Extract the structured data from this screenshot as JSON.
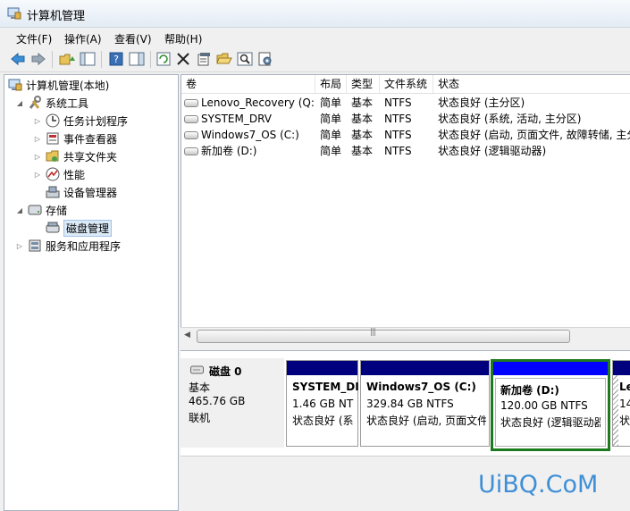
{
  "window": {
    "title": "计算机管理"
  },
  "menu": [
    "文件(F)",
    "操作(A)",
    "查看(V)",
    "帮助(H)"
  ],
  "toolbar": [
    "back-icon",
    "forward-icon",
    "up-folder-icon",
    "show-hide-tree-icon",
    "help-icon",
    "panel-icon",
    "refresh-icon",
    "delete-icon",
    "properties-icon",
    "open-icon",
    "search-icon",
    "settings-icon"
  ],
  "tree": {
    "root": "计算机管理(本地)",
    "system_tools": "系统工具",
    "task_scheduler": "任务计划程序",
    "event_viewer": "事件查看器",
    "shared_folders": "共享文件夹",
    "performance": "性能",
    "device_manager": "设备管理器",
    "storage": "存储",
    "disk_management": "磁盘管理",
    "services_apps": "服务和应用程序"
  },
  "volumes": {
    "columns": [
      "卷",
      "布局",
      "类型",
      "文件系统",
      "状态"
    ],
    "rows": [
      [
        "Lenovo_Recovery (Q:)",
        "简单",
        "基本",
        "NTFS",
        "状态良好 (主分区)"
      ],
      [
        "SYSTEM_DRV",
        "简单",
        "基本",
        "NTFS",
        "状态良好 (系统, 活动, 主分区)"
      ],
      [
        "Windows7_OS (C:)",
        "简单",
        "基本",
        "NTFS",
        "状态良好 (启动, 页面文件, 故障转储, 主分"
      ],
      [
        "新加卷 (D:)",
        "简单",
        "基本",
        "NTFS",
        "状态良好 (逻辑驱动器)"
      ]
    ]
  },
  "disk": {
    "name": "磁盘 0",
    "type": "基本",
    "size": "465.76 GB",
    "status": "联机",
    "partitions": [
      {
        "name": "SYSTEM_DI",
        "size": "1.46 GB NT",
        "status": "状态良好 (系"
      },
      {
        "name": "Windows7_OS (C:)",
        "size": "329.84 GB NTFS",
        "status": "状态良好 (启动, 页面文件"
      },
      {
        "name": "新加卷 (D:)",
        "size": "120.00 GB NTFS",
        "status": "状态良好 (逻辑驱动器"
      },
      {
        "name": "Le",
        "size": "14",
        "status": "状态"
      }
    ]
  },
  "watermark": "UiBQ.CoM",
  "colors": {
    "primary_bar": "#00007f",
    "logical_bar": "#0000ff",
    "selected_border": "#1e7a1e"
  }
}
